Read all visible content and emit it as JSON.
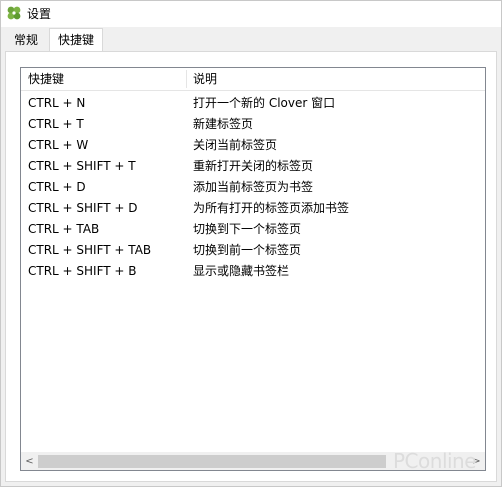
{
  "window": {
    "title": "设置",
    "icon": "clover-icon",
    "accent": "#6ca43a"
  },
  "tabs": [
    {
      "label": "常规",
      "active": false
    },
    {
      "label": "快捷键",
      "active": true
    }
  ],
  "list": {
    "columns": {
      "key": "快捷键",
      "desc": "说明"
    },
    "rows": [
      {
        "key": "CTRL + N",
        "desc": "打开一个新的 Clover 窗口"
      },
      {
        "key": "CTRL + T",
        "desc": "新建标签页"
      },
      {
        "key": "CTRL + W",
        "desc": "关闭当前标签页"
      },
      {
        "key": "CTRL + SHIFT + T",
        "desc": "重新打开关闭的标签页"
      },
      {
        "key": "CTRL + D",
        "desc": "添加当前标签页为书签"
      },
      {
        "key": "CTRL + SHIFT + D",
        "desc": "为所有打开的标签页添加书签"
      },
      {
        "key": "CTRL + TAB",
        "desc": "切换到下一个标签页"
      },
      {
        "key": "CTRL + SHIFT + TAB",
        "desc": "切换到前一个标签页"
      },
      {
        "key": "CTRL + SHIFT + B",
        "desc": "显示或隐藏书签栏"
      }
    ]
  },
  "scrollbar": {
    "left_arrow": "<",
    "right_arrow": ">"
  },
  "watermark": "PConline"
}
